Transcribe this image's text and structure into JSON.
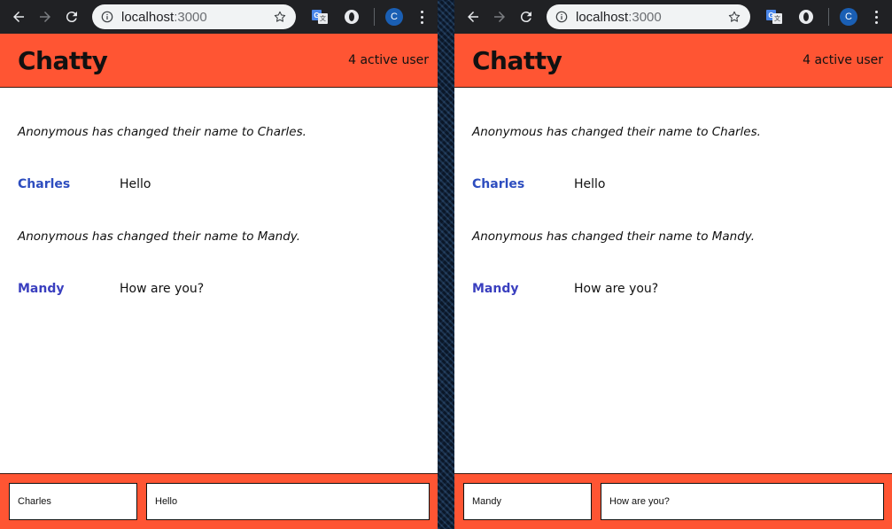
{
  "windows": [
    {
      "side": "left",
      "browser": {
        "url_host": "localhost",
        "url_port": ":3000",
        "avatar_letter": "C"
      },
      "app": {
        "brand": "Chatty",
        "user_count": "4 active user",
        "messages": [
          {
            "type": "system",
            "text": "Anonymous has changed their name to Charles."
          },
          {
            "type": "chat",
            "username": "Charles",
            "username_color": "#2d4dbf",
            "content": "Hello"
          },
          {
            "type": "system",
            "text": "Anonymous has changed their name to Mandy."
          },
          {
            "type": "chat",
            "username": "Mandy",
            "username_color": "#3a3fbf",
            "content": "How are you?"
          }
        ],
        "chatbar": {
          "name_value": "Charles",
          "message_value": "Hello"
        }
      }
    },
    {
      "side": "right",
      "browser": {
        "url_host": "localhost",
        "url_port": ":3000",
        "avatar_letter": "C"
      },
      "app": {
        "brand": "Chatty",
        "user_count": "4 active user",
        "messages": [
          {
            "type": "system",
            "text": "Anonymous has changed their name to Charles."
          },
          {
            "type": "chat",
            "username": "Charles",
            "username_color": "#2d4dbf",
            "content": "Hello"
          },
          {
            "type": "system",
            "text": "Anonymous has changed their name to Mandy."
          },
          {
            "type": "chat",
            "username": "Mandy",
            "username_color": "#3a3fbf",
            "content": "How are you?"
          }
        ],
        "chatbar": {
          "name_value": "Mandy",
          "message_value": "How are you?"
        }
      }
    }
  ],
  "colors": {
    "accent": "#ff5533",
    "chrome": "#202124"
  },
  "icons": [
    "back-arrow-icon",
    "forward-arrow-icon",
    "reload-icon",
    "info-icon",
    "star-icon",
    "translate-icon",
    "extension-icon",
    "menu-icon"
  ]
}
